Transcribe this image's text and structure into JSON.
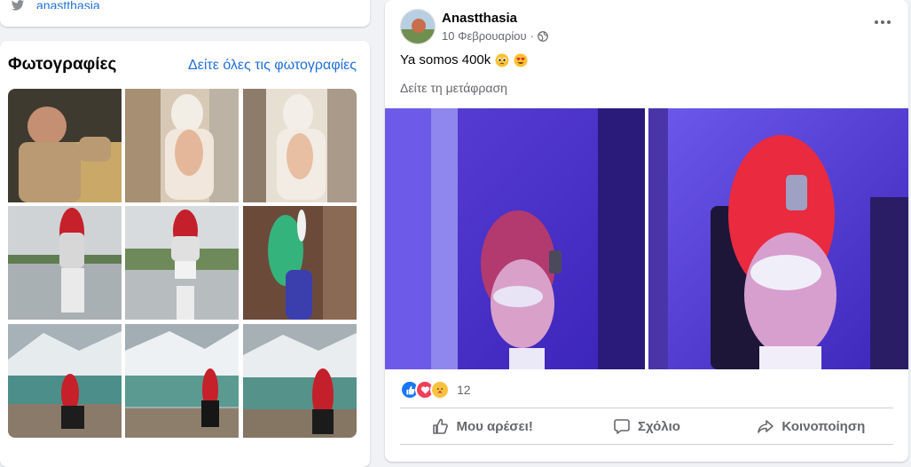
{
  "top_card": {
    "handle": "anastthasia",
    "icon": "twitter-icon"
  },
  "photos": {
    "title": "Φωτογραφίες",
    "see_all": "Δείτε όλες τις φωτογραφίες"
  },
  "post": {
    "author": "Anastthasia",
    "date": "10 Φεβρουαρίου",
    "separator": "·",
    "text": "Ya somos 400k",
    "see_translation": "Δείτε τη μετάφραση",
    "reaction_count": "12",
    "actions": {
      "like": "Μου αρέσει!",
      "comment": "Σχόλιο",
      "share": "Κοινοποίηση"
    }
  },
  "colors": {
    "link": "#216fdb",
    "secondary_text": "#65676b",
    "like_blue": "#1877f2",
    "love_red": "#f33e58"
  }
}
